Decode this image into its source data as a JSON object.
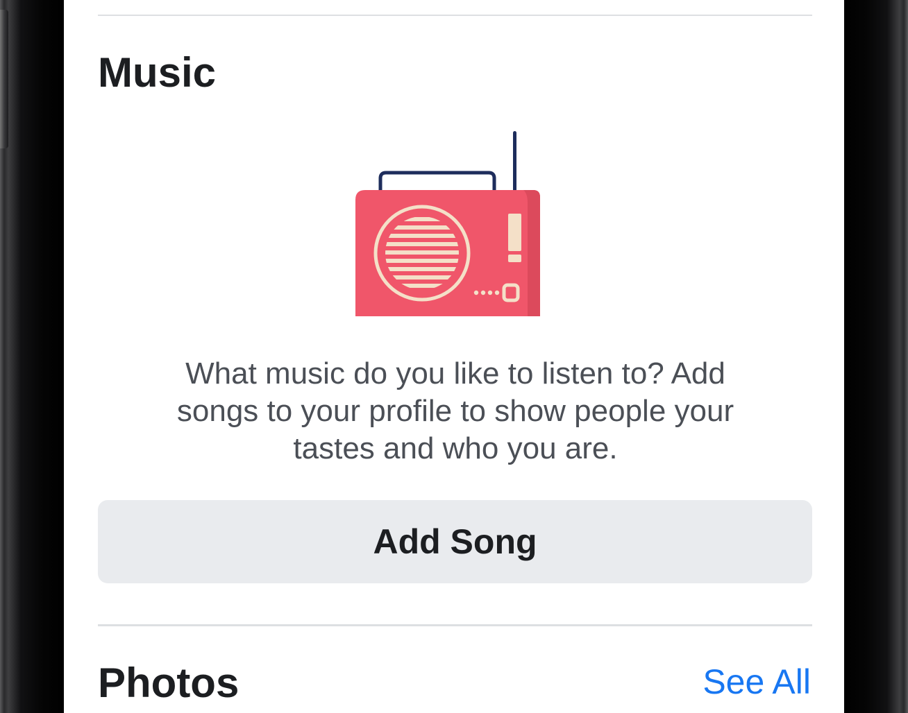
{
  "music": {
    "title": "Music",
    "illustration": "radio-icon",
    "description": "What music do you like to listen to? Add songs to your profile to show people your tastes and who you are.",
    "add_song_label": "Add Song"
  },
  "photos": {
    "title": "Photos",
    "see_all_label": "See All"
  },
  "colors": {
    "radio_body": "#f0566a",
    "radio_accent": "#f4e0c8",
    "radio_handle": "#1e2d5c",
    "link": "#1877f2",
    "button_bg": "#e9ebee"
  }
}
